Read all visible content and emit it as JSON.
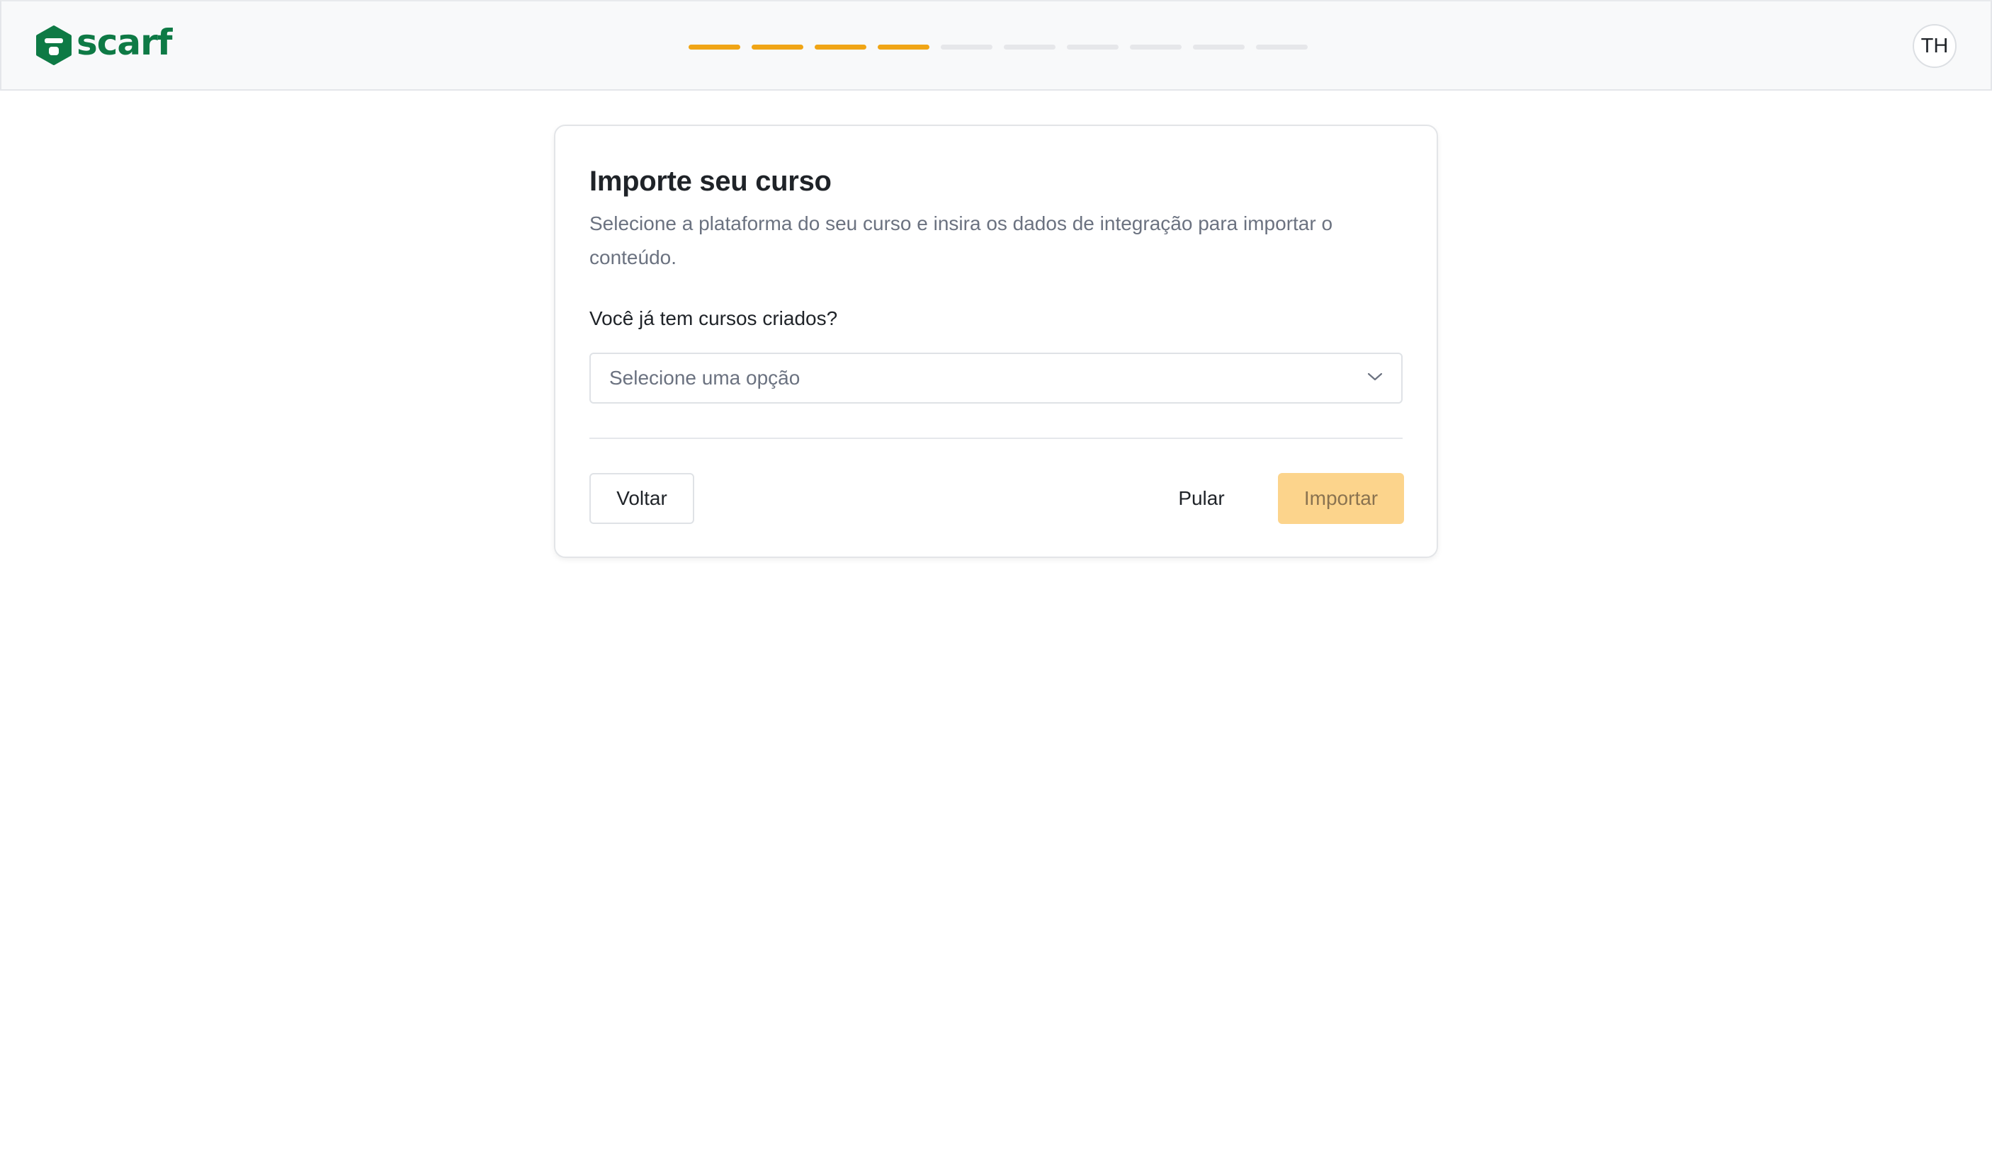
{
  "header": {
    "logo_text": "scarf",
    "logo_icon": "scarf-hexagon-logo-icon",
    "progress": {
      "total_steps": 10,
      "completed_steps": 4
    },
    "avatar_initials": "TH"
  },
  "card": {
    "title": "Importe seu curso",
    "subtitle": "Selecione a plataforma do seu curso e insira os dados de integração para importar o conteúdo.",
    "question_label": "Você já tem cursos criados?",
    "select": {
      "placeholder": "Selecione uma opção",
      "icon": "chevron-down-icon"
    },
    "buttons": {
      "back": "Voltar",
      "skip": "Pular",
      "import": "Importar"
    }
  },
  "colors": {
    "brand_green": "#0e7a45",
    "progress_done": "#f0a515",
    "progress_todo": "#e6e7ea",
    "import_disabled_bg": "#fcd48c"
  }
}
